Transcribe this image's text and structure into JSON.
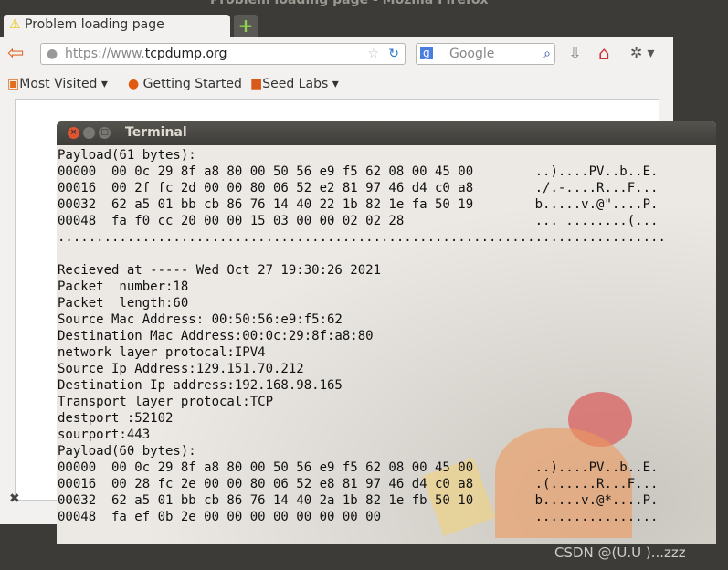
{
  "window_title": "Problem loading page - Mozilla Firefox",
  "browser": {
    "tab_label": "Problem loading page",
    "url_prefix": "https://www.",
    "url_domain": "tcpdump.org",
    "search_placeholder": "Google",
    "bookmarks": [
      "Most Visited",
      "Getting Started",
      "Seed Labs"
    ]
  },
  "terminal": {
    "title": "Terminal",
    "lines": [
      "Payload(61 bytes):",
      "00000  00 0c 29 8f a8 80 00 50 56 e9 f5 62 08 00 45 00        ..)....PV..b..E.",
      "00016  00 2f fc 2d 00 00 80 06 52 e2 81 97 46 d4 c0 a8        ./.-....R...F...",
      "00032  62 a5 01 bb cb 86 76 14 40 22 1b 82 1e fa 50 19        b.....v.@\"....P.",
      "00048  fa f0 cc 20 00 00 15 03 00 00 02 02 28                 ... ........(...",
      "...............................................................................",
      "",
      "Recieved at ----- Wed Oct 27 19:30:26 2021",
      "Packet  number:18",
      "Packet  length:60",
      "Source Mac Address: 00:50:56:e9:f5:62",
      "Destination Mac Address:00:0c:29:8f:a8:80",
      "network layer protocal:IPV4",
      "Source Ip Address:129.151.70.212",
      "Destination Ip address:192.168.98.165",
      "Transport layer protocal:TCP",
      "destport :52102",
      "sourport:443",
      "Payload(60 bytes):",
      "00000  00 0c 29 8f a8 80 00 50 56 e9 f5 62 08 00 45 00        ..)....PV..b..E.",
      "00016  00 28 fc 2e 00 00 80 06 52 e8 81 97 46 d4 c0 a8        .(......R...F...",
      "00032  62 a5 01 bb cb 86 76 14 40 2a 1b 82 1e fb 50 10        b.....v.@*....P.",
      "00048  fa ef 0b 2e 00 00 00 00 00 00 00 00                    ................"
    ]
  },
  "watermark": "CSDN @(U.U )...zzz"
}
